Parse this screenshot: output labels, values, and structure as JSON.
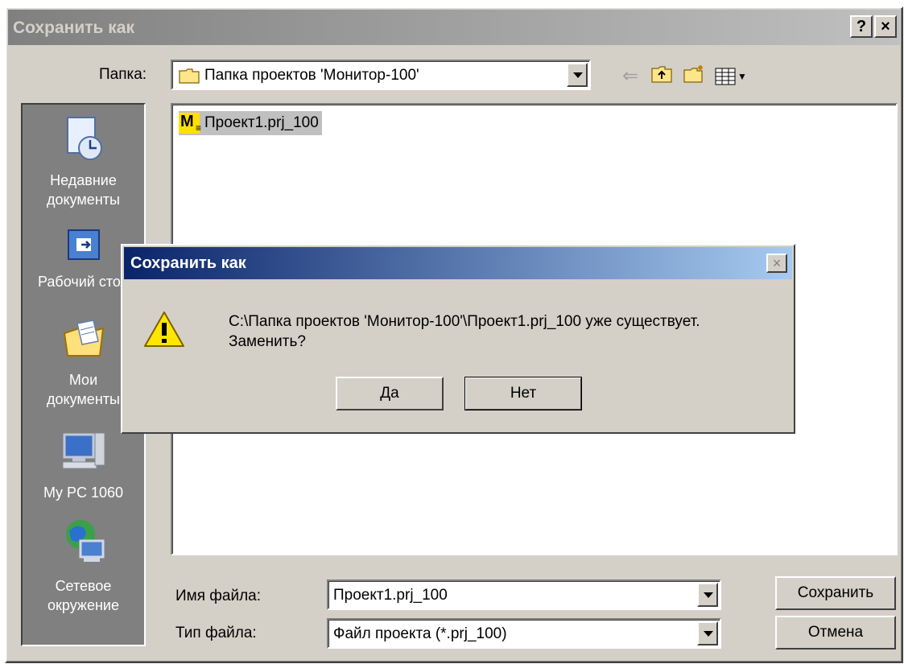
{
  "window": {
    "title": "Сохранить как",
    "help_button": "?",
    "close_button": "×"
  },
  "toolbar": {
    "folder_label": "Папка:",
    "folder_value": "Папка проектов 'Монитор-100'"
  },
  "places": [
    {
      "label_line1": "Недавние",
      "label_line2": "документы",
      "icon": "recent-documents-icon"
    },
    {
      "label_line1": "Рабочий стол",
      "label_line2": "",
      "icon": "desktop-icon"
    },
    {
      "label_line1": "Мои",
      "label_line2": "документы",
      "icon": "my-documents-icon"
    },
    {
      "label_line1": "My PC 1060",
      "label_line2": "",
      "icon": "my-computer-icon"
    },
    {
      "label_line1": "Сетевое",
      "label_line2": "окружение",
      "icon": "network-icon"
    }
  ],
  "files": [
    {
      "name": "Проект1.prj_100",
      "icon_letter": "M"
    }
  ],
  "form": {
    "filename_label": "Имя файла:",
    "filename_value": "Проект1.prj_100",
    "filetype_label": "Тип файла:",
    "filetype_value": "Файл проекта (*.prj_100)",
    "save_button": "Сохранить",
    "cancel_button": "Отмена"
  },
  "message_box": {
    "title": "Сохранить как",
    "close_button": "×",
    "text_line1": "C:\\Папка проектов 'Монитор-100'\\Проект1.prj_100 уже существует.",
    "text_line2": "Заменить?",
    "yes_button": "Да",
    "no_button": "Нет",
    "icon": "warning-icon"
  }
}
